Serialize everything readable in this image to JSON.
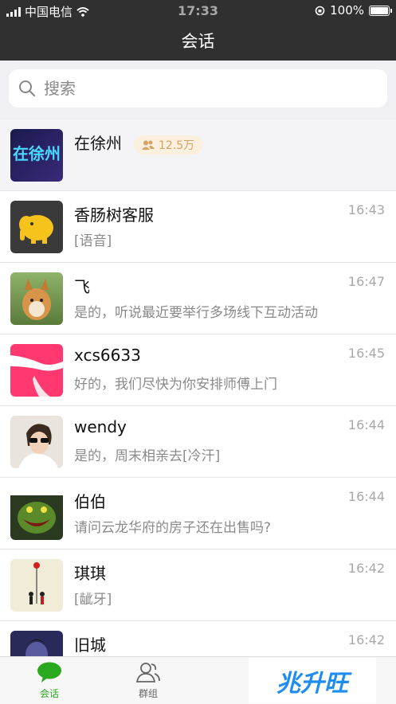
{
  "status_bar": {
    "carrier": "中国电信",
    "time": "17:33",
    "battery": "100%"
  },
  "header": {
    "title": "会话"
  },
  "search": {
    "placeholder": "搜索"
  },
  "pinned": {
    "name": "在徐州",
    "member_count": "12.5万",
    "avatar_text": "在徐州"
  },
  "conversations": [
    {
      "name": "香肠树客服",
      "preview": "[语音]",
      "time": "16:43"
    },
    {
      "name": "飞",
      "preview": "是的，听说最近要举行多场线下互动活动",
      "time": "16:47"
    },
    {
      "name": "xcs6633",
      "preview": "好的，我们尽快为你安排师傅上门",
      "time": "16:45"
    },
    {
      "name": "wendy",
      "preview": "是的，周末相亲去[冷汗]",
      "time": "16:44"
    },
    {
      "name": "伯伯",
      "preview": "请问云龙华府的房子还在出售吗?",
      "time": "16:44"
    },
    {
      "name": "琪琪",
      "preview": "[龇牙]",
      "time": "16:42"
    },
    {
      "name": "旧城",
      "preview": "",
      "time": "16:42"
    }
  ],
  "tabs": [
    {
      "label": "会话",
      "icon": "chat-bubble-icon"
    },
    {
      "label": "群组",
      "icon": "group-icon"
    }
  ],
  "watermark": {
    "text": "兆升旺"
  },
  "colors": {
    "header_bg": "#303030",
    "accent_green": "#2aa81e",
    "badge_bg": "#fbefdd",
    "badge_text": "#d6a367"
  }
}
